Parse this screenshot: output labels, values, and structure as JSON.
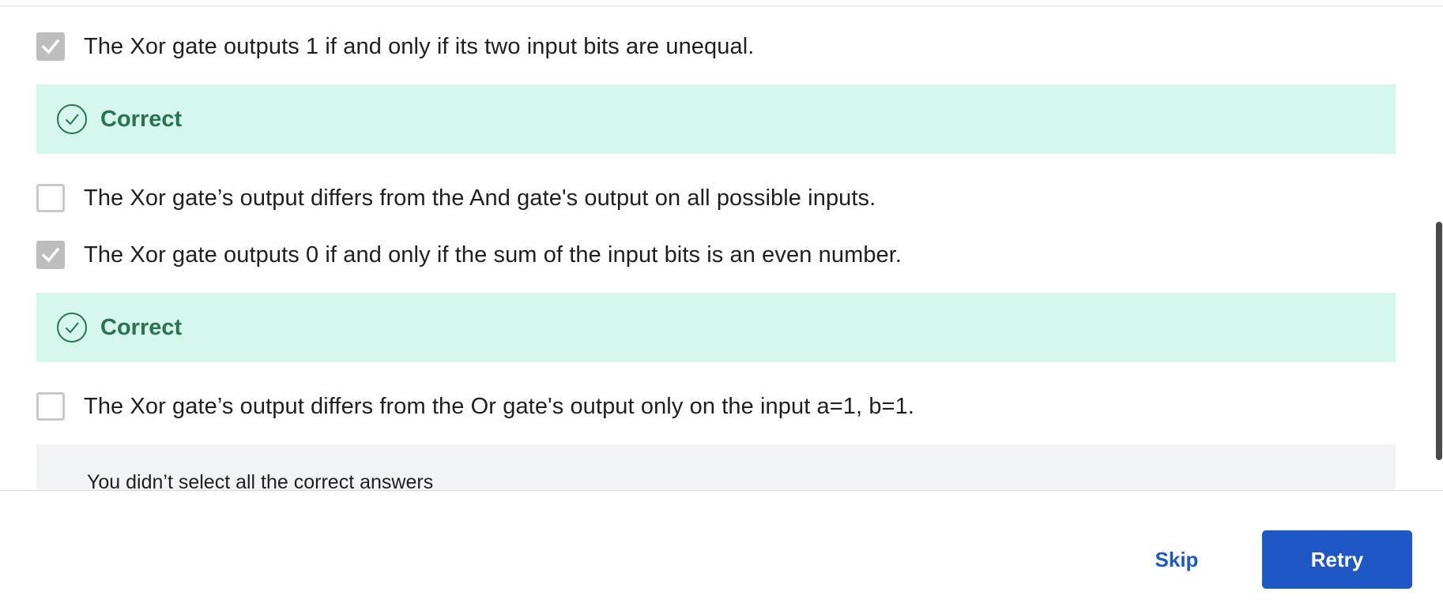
{
  "options": [
    {
      "text": "The Xor gate outputs 1 if and only if its two input bits are unequal.",
      "checked": true,
      "feedback": "Correct"
    },
    {
      "text": "The Xor gate’s output differs from the And gate's output on all possible inputs.",
      "checked": false,
      "feedback": ""
    },
    {
      "text": "The Xor gate outputs 0 if and only if the sum of the input bits is an even number.",
      "checked": true,
      "feedback": "Correct"
    },
    {
      "text": "The Xor gate’s output differs from the Or gate's output only on the input a=1, b=1.",
      "checked": false,
      "feedback": ""
    }
  ],
  "summary": {
    "message": "You didn’t select all the correct answers"
  },
  "footer": {
    "skip_label": "Skip",
    "retry_label": "Retry"
  },
  "colors": {
    "correct_background": "#d4f6ec",
    "correct_text": "#2a7350",
    "primary": "#1f57c7",
    "summary_background": "#f2f3f6"
  },
  "icons": {
    "checkmark": "check-icon",
    "correct": "check-circle-icon"
  }
}
